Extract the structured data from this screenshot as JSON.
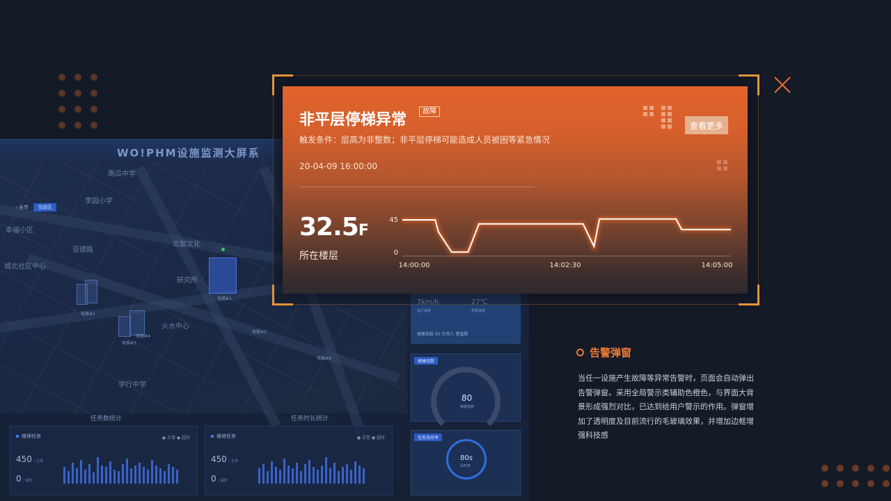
{
  "background": {
    "title": "WO!PHM设施监测大屏系",
    "map": {
      "back_label": "‹ 全市",
      "tag_label": "当前区",
      "labels": [
        "南瓜中学",
        "李园小学",
        "幸福小区",
        "亚德路",
        "北部文化",
        "城北社区中心",
        "研究所",
        "火水中心",
        "学行中学"
      ],
      "elevators": [
        "电梯#2",
        "电梯#3",
        "电梯#1",
        "电梯#4",
        "电梯#5",
        "电梯#6"
      ]
    },
    "panels": [
      {
        "title": "任务数统计",
        "head": "维保任务",
        "legend": "● 正常  ● 超时",
        "value1": "450",
        "unit1": "/ 正常",
        "value2": "0",
        "unit2": "/ 超时"
      },
      {
        "title": "任务时长统计",
        "head": "维修任务",
        "legend": "● 正常  ● 超时",
        "value1": "450",
        "unit1": "/ 正常",
        "value2": "0",
        "unit2": "/ 超时"
      }
    ],
    "cards": {
      "speed": "7km/h",
      "speed_label": "运行速度",
      "temp": "27℃",
      "temp_label": "机箱温度",
      "row": "健康指数  90        负责人  董鑫鹏",
      "health_tag": "健康指数",
      "health_value": "80",
      "health_label": "健康指数",
      "rate_tag": "任务及时率",
      "rate_value": "80s",
      "rate_label": "及时率"
    }
  },
  "alert": {
    "title": "非平层停梯异常",
    "badge": "故障",
    "trigger": "触发条件：层高为非整数；非平层停梯可能造成人员被困等紧急情况",
    "time": "20-04-09 16:00:00",
    "view_more": "查看更多",
    "floor_value": "32.5",
    "floor_unit": "F",
    "floor_label": "所在楼层",
    "accent": "#e0632a"
  },
  "chart_data": {
    "type": "line",
    "x": [
      "14:00:00",
      "14:00:30",
      "14:00:33",
      "14:00:45",
      "14:01:00",
      "14:01:10",
      "14:01:45",
      "14:02:45",
      "14:02:55",
      "14:03:00",
      "14:04:10",
      "14:04:15",
      "14:05:00"
    ],
    "values": [
      45,
      45,
      30,
      5,
      5,
      40,
      40,
      40,
      12,
      46,
      46,
      33,
      33
    ],
    "ylim": [
      0,
      45
    ],
    "yticks": [
      "45",
      "0"
    ],
    "xticks": [
      "14:00:00",
      "14:02:30",
      "14:05:00"
    ],
    "title": "",
    "xlabel": "",
    "ylabel": ""
  },
  "description": {
    "title": "告警弹窗",
    "body": "当任一设施产生故障等异常告警时，页面会自动弹出告警弹窗。采用全局警示类辅助色橙色，与界面大背景形成强烈对比，已达到给用户警示的作用。弹窗增加了透明度及目前流行的毛玻璃效果，并增加边框增强科技感"
  }
}
